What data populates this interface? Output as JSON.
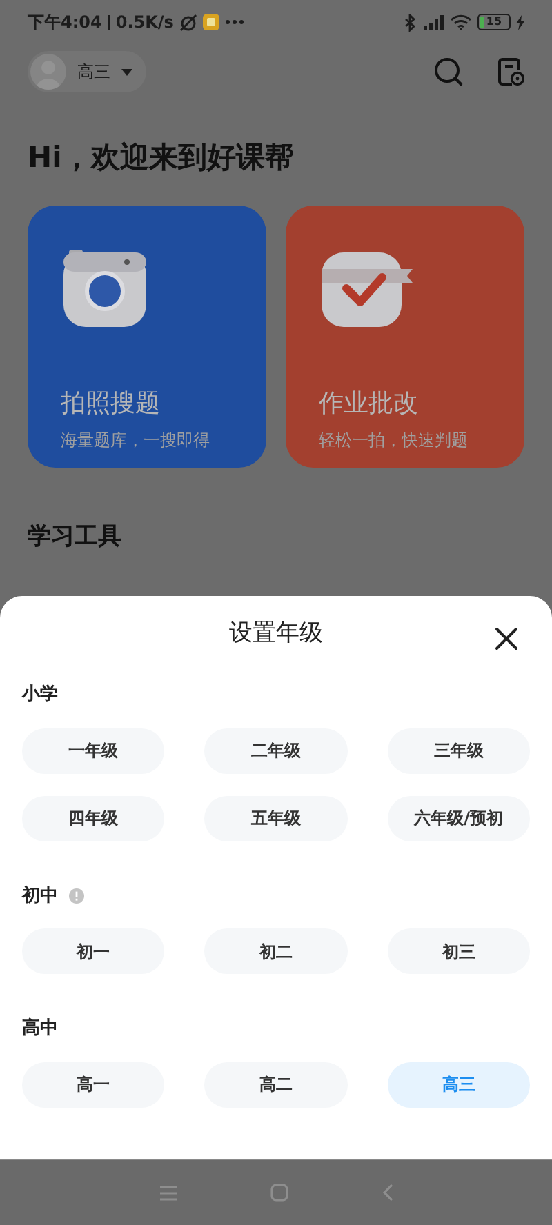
{
  "status_bar": {
    "time": "下午4:04",
    "speed": "0.5K/s",
    "battery": "15",
    "charging": true
  },
  "header": {
    "grade": "高三"
  },
  "greeting": "Hi，欢迎来到好课帮",
  "cards": [
    {
      "kind": "camera",
      "title": "拍照搜题",
      "subtitle": "海量题库，一搜即得",
      "color": "#1f4d9e"
    },
    {
      "kind": "check",
      "title": "作业批改",
      "subtitle": "轻松一拍，快速判题",
      "color": "#a3402f"
    }
  ],
  "tools_title": "学习工具",
  "sheet": {
    "title": "设置年级",
    "sections": [
      {
        "name": "小学",
        "info_icon": false,
        "grades": [
          {
            "label": "一年级",
            "selected": false
          },
          {
            "label": "二年级",
            "selected": false
          },
          {
            "label": "三年级",
            "selected": false
          },
          {
            "label": "四年级",
            "selected": false
          },
          {
            "label": "五年级",
            "selected": false
          },
          {
            "label": "六年级/预初",
            "selected": false
          }
        ]
      },
      {
        "name": "初中",
        "info_icon": true,
        "grades": [
          {
            "label": "初一",
            "selected": false
          },
          {
            "label": "初二",
            "selected": false
          },
          {
            "label": "初三",
            "selected": false
          }
        ]
      },
      {
        "name": "高中",
        "info_icon": false,
        "grades": [
          {
            "label": "高一",
            "selected": false
          },
          {
            "label": "高二",
            "selected": false
          },
          {
            "label": "高三",
            "selected": true
          }
        ]
      }
    ]
  }
}
